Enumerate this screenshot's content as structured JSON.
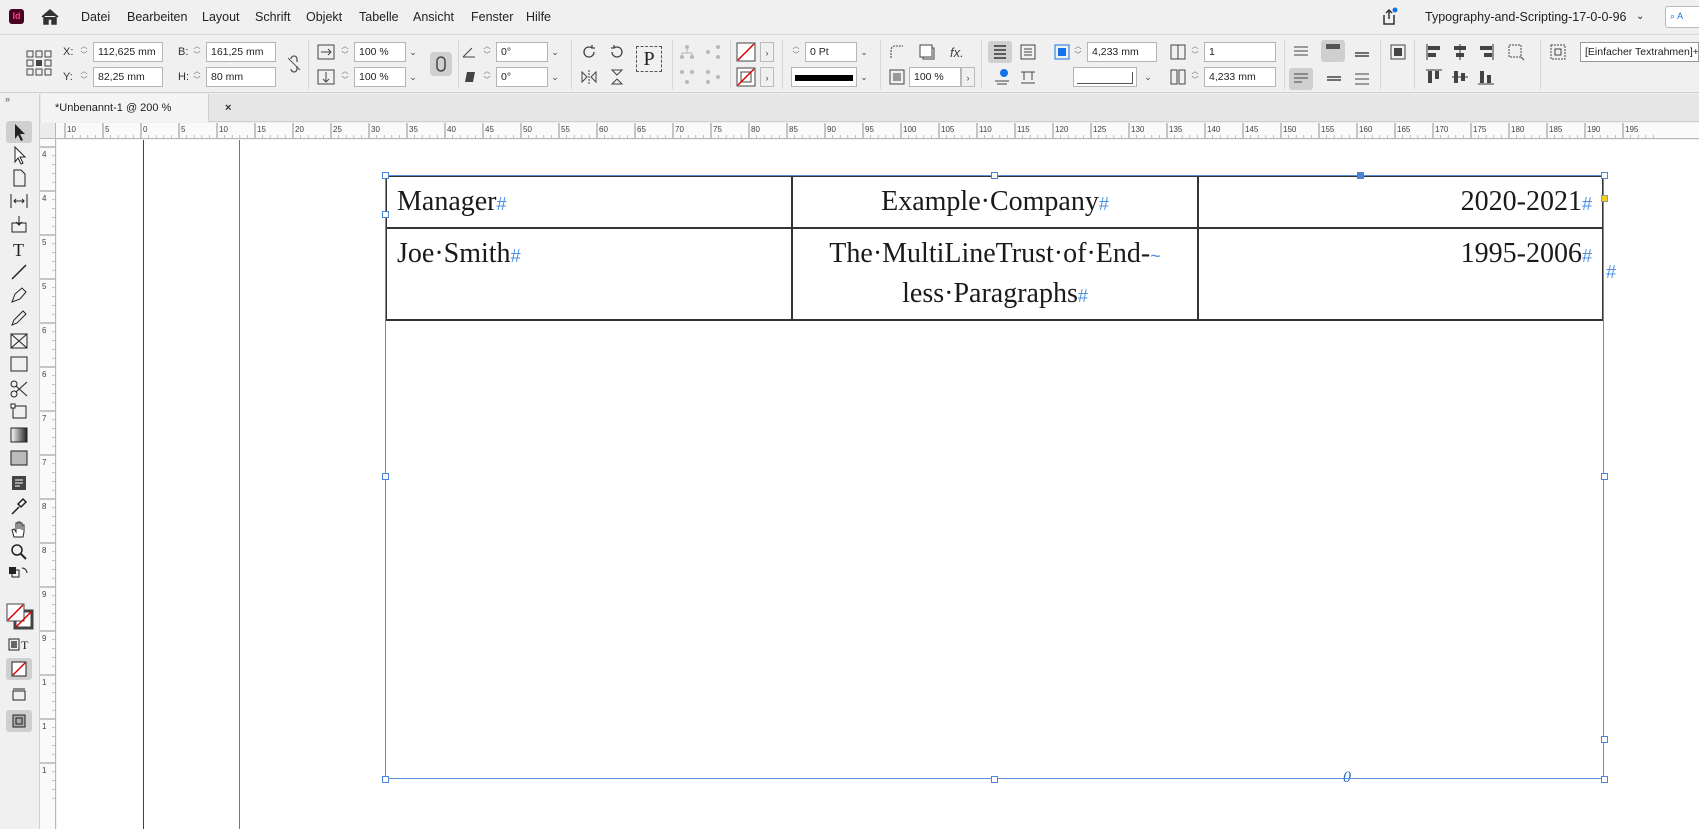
{
  "app": {
    "logo": "Id",
    "document_title": "Typography-and-Scripting-17-0-0-96",
    "search_hint": "A"
  },
  "menu": [
    "Datei",
    "Bearbeiten",
    "Layout",
    "Schrift",
    "Objekt",
    "Tabelle",
    "Ansicht",
    "Fenster",
    "Hilfe"
  ],
  "control": {
    "x_label": "X:",
    "x_value": "112,625 mm",
    "y_label": "Y:",
    "y_value": "82,25 mm",
    "w_label": "B:",
    "w_value": "161,25 mm",
    "h_label": "H:",
    "h_value": "80 mm",
    "scale_x": "100 %",
    "scale_y": "100 %",
    "rotate": "0°",
    "shear": "0°",
    "stroke_weight": "0 Pt",
    "opacity": "100 %",
    "inset_top": "4,233 mm",
    "inset_bottom": "4,233 mm",
    "columns": "1",
    "frame_style": "[Einfacher Textrahmen]+",
    "text_p": "P"
  },
  "tab": {
    "label": "*Unbenannt-1 @ 200 %",
    "close": "×"
  },
  "ruler": {
    "h_labels": [
      "10",
      "5",
      "0",
      "5",
      "10",
      "15",
      "20",
      "25",
      "30",
      "35",
      "40",
      "45",
      "50",
      "55",
      "60",
      "65",
      "70",
      "75",
      "80",
      "85",
      "90",
      "95",
      "100",
      "105",
      "110",
      "115",
      "120",
      "125",
      "130",
      "135",
      "140",
      "145",
      "150",
      "155",
      "160",
      "165",
      "170",
      "175",
      "180",
      "185",
      "190",
      "195"
    ],
    "v_labels": [
      "4",
      "4",
      "5",
      "5",
      "6",
      "6",
      "7",
      "7",
      "8",
      "8",
      "9",
      "9",
      "1",
      "1",
      "1"
    ]
  },
  "table": {
    "rows": [
      [
        "Manager",
        "Example·Company",
        "2020-2021"
      ],
      [
        "Joe·Smith",
        "The·MultiLineTrust·of·End-less·Paragraphs",
        "1995-2006"
      ]
    ],
    "row2_center_line1": "The·MultiLineTrust·of·End-",
    "row2_center_line2": "less·Paragraphs",
    "end_mark": "#",
    "overset_mark": "~",
    "frame_end_mark": "#",
    "story_end": "0"
  },
  "colors": {
    "accent": "#1473e6",
    "frame_blue": "#4a86d8",
    "margin_purple": "#a050c8"
  }
}
